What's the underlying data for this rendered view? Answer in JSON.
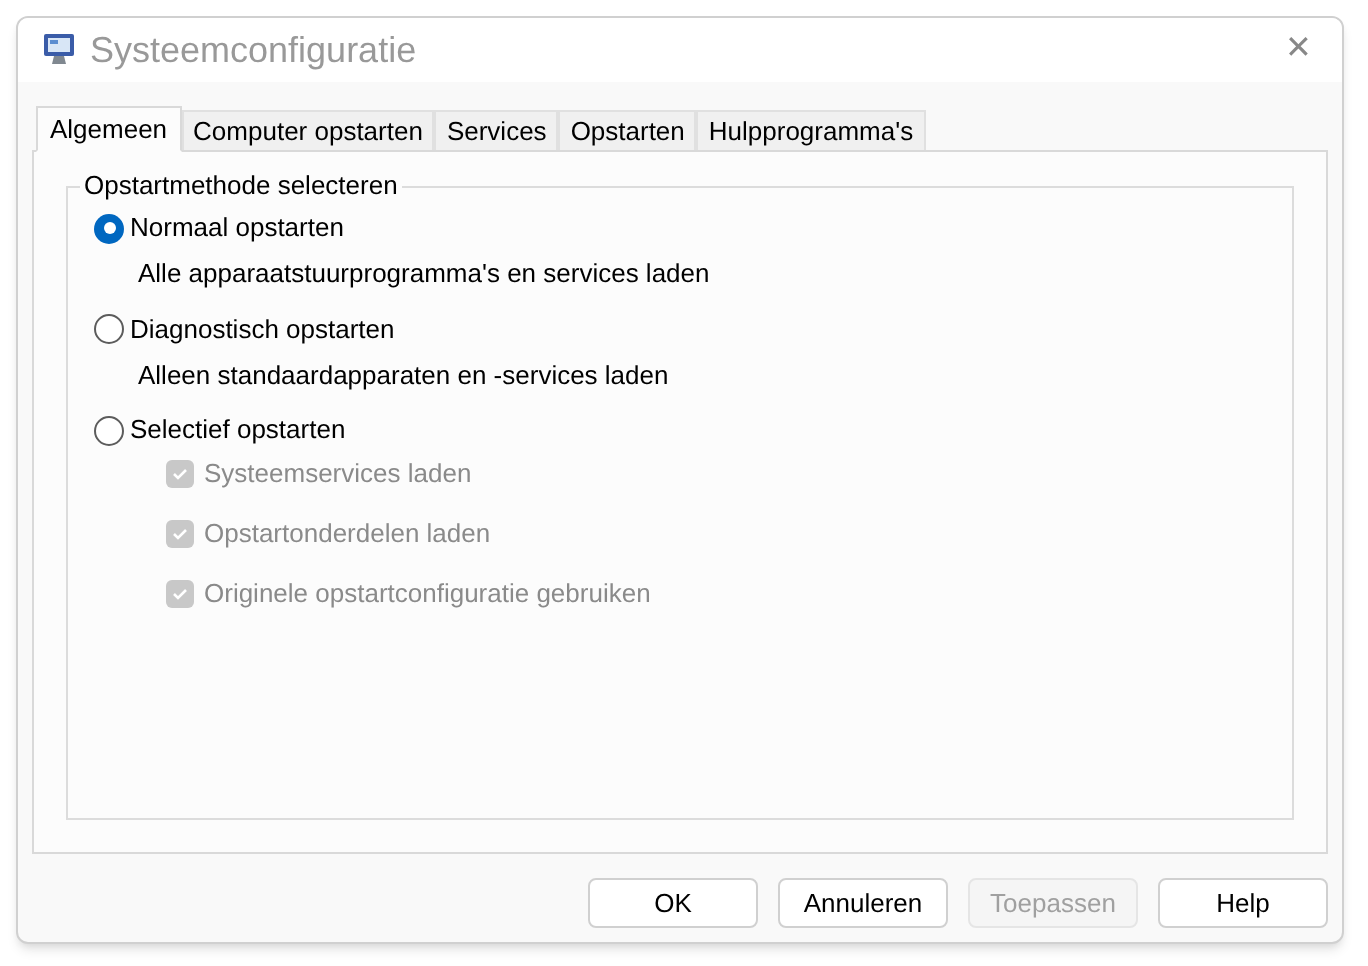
{
  "window": {
    "title": "Systeemconfiguratie",
    "close": "✕"
  },
  "tabs": [
    {
      "label": "Algemeen",
      "selected": true
    },
    {
      "label": "Computer opstarten",
      "selected": false
    },
    {
      "label": "Services",
      "selected": false
    },
    {
      "label": "Opstarten",
      "selected": false
    },
    {
      "label": "Hulpprogramma's",
      "selected": false
    }
  ],
  "group": {
    "title": "Opstartmethode selecteren",
    "options": [
      {
        "label": "Normaal opstarten",
        "selected": true,
        "description": "Alle apparaatstuurprogramma's en services laden"
      },
      {
        "label": "Diagnostisch opstarten",
        "selected": false,
        "description": "Alleen standaardapparaten en -services laden"
      },
      {
        "label": "Selectief opstarten",
        "selected": false,
        "checkboxes": [
          {
            "label": "Systeemservices laden",
            "checked": true,
            "disabled": true
          },
          {
            "label": "Opstartonderdelen laden",
            "checked": true,
            "disabled": true
          },
          {
            "label": "Originele opstartconfiguratie gebruiken",
            "checked": true,
            "disabled": true
          }
        ]
      }
    ]
  },
  "buttons": [
    {
      "label": "OK",
      "disabled": false
    },
    {
      "label": "Annuleren",
      "disabled": false
    },
    {
      "label": "Toepassen",
      "disabled": true
    },
    {
      "label": "Help",
      "disabled": false
    }
  ]
}
